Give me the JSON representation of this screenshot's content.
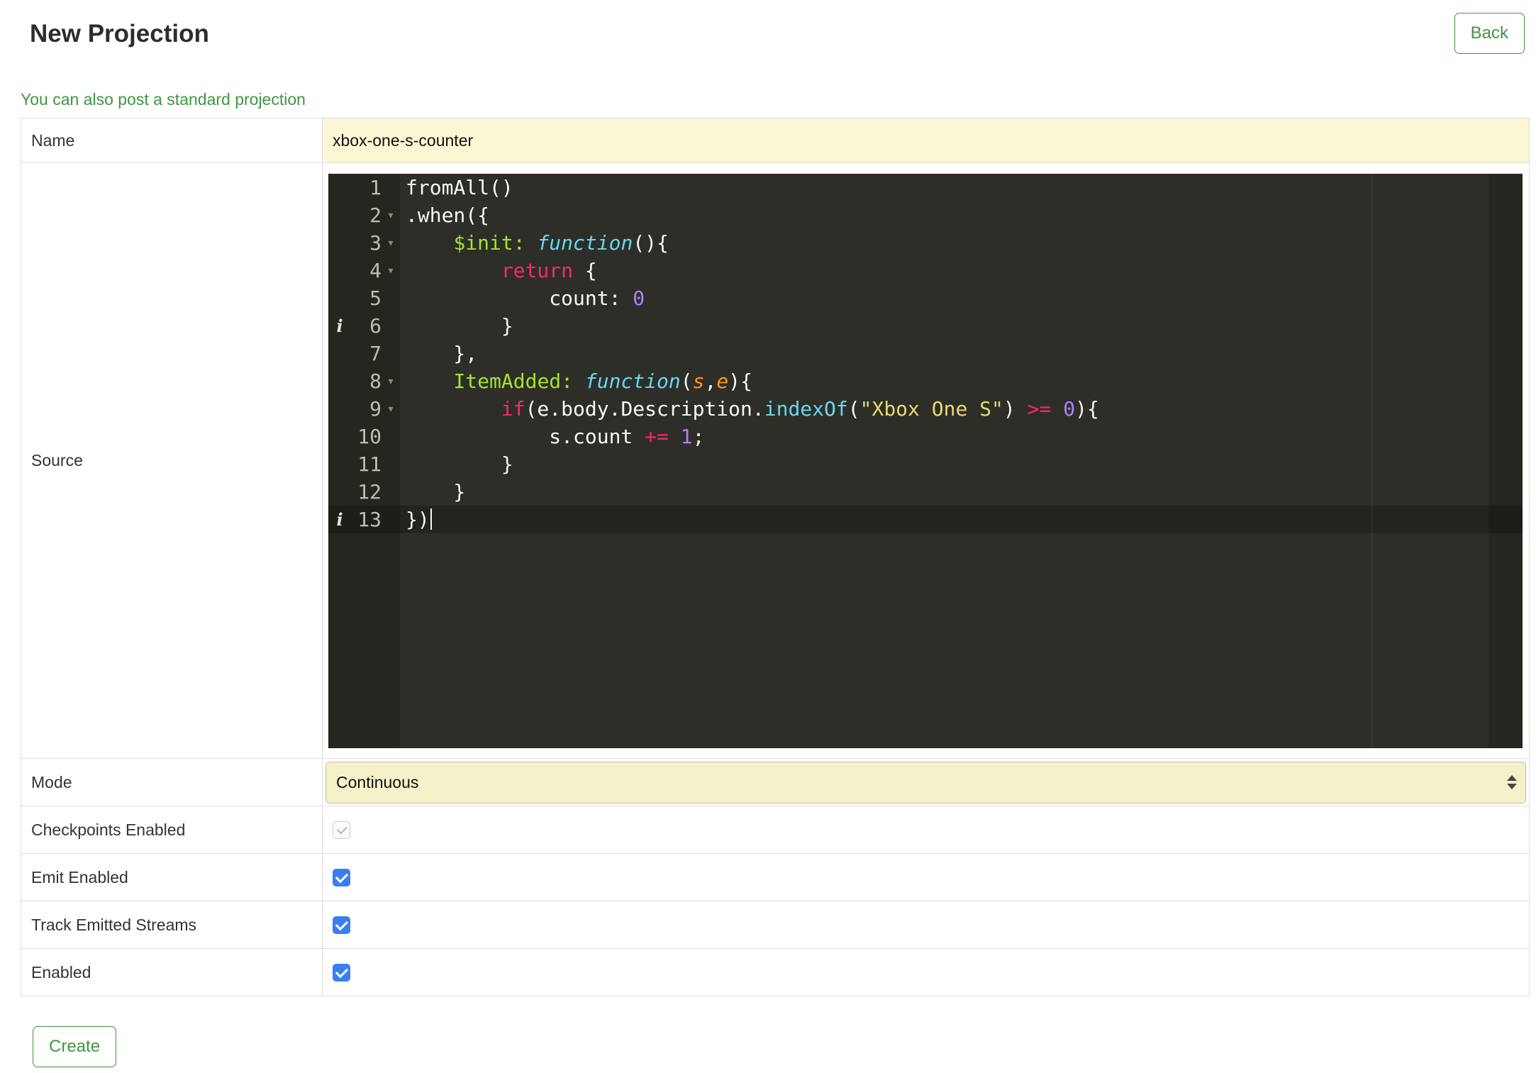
{
  "page": {
    "title": "New Projection",
    "back_label": "Back",
    "standard_link": "You can also post a standard projection",
    "create_label": "Create"
  },
  "form": {
    "name": {
      "label": "Name",
      "value": "xbox-one-s-counter"
    },
    "source": {
      "label": "Source"
    },
    "mode": {
      "label": "Mode",
      "value": "Continuous"
    },
    "checkpoints": {
      "label": "Checkpoints Enabled",
      "checked": true,
      "disabled": true
    },
    "emit": {
      "label": "Emit Enabled",
      "checked": true,
      "disabled": false
    },
    "track": {
      "label": "Track Emitted Streams",
      "checked": true,
      "disabled": false
    },
    "enabled": {
      "label": "Enabled",
      "checked": true,
      "disabled": false
    }
  },
  "editor": {
    "line_count": 13,
    "active_line": 13,
    "cursor_line": 13,
    "fold_lines": [
      2,
      3,
      4,
      8,
      9
    ],
    "info_lines": [
      6,
      13
    ],
    "icons": {
      "fold_open": "▾",
      "info": "i"
    },
    "lines": [
      [
        [
          "fromAll()",
          "t"
        ]
      ],
      [
        [
          ".when({",
          "t"
        ]
      ],
      [
        [
          "    ",
          "t"
        ],
        [
          "$init:",
          "p"
        ],
        [
          " ",
          "t"
        ],
        [
          "function",
          "f"
        ],
        [
          "(){",
          "t"
        ]
      ],
      [
        [
          "        ",
          "t"
        ],
        [
          "return",
          "k"
        ],
        [
          " {",
          "t"
        ]
      ],
      [
        [
          "            count: ",
          "t"
        ],
        [
          "0",
          "n"
        ]
      ],
      [
        [
          "        }",
          "t"
        ]
      ],
      [
        [
          "    },",
          "t"
        ]
      ],
      [
        [
          "    ",
          "t"
        ],
        [
          "ItemAdded:",
          "p"
        ],
        [
          " ",
          "t"
        ],
        [
          "function",
          "f"
        ],
        [
          "(",
          "t"
        ],
        [
          "s",
          "a"
        ],
        [
          ",",
          "t"
        ],
        [
          "e",
          "a"
        ],
        [
          "){",
          "t"
        ]
      ],
      [
        [
          "        ",
          "t"
        ],
        [
          "if",
          "k"
        ],
        [
          "(e.body.Description.",
          "t"
        ],
        [
          "indexOf",
          "b"
        ],
        [
          "(",
          "t"
        ],
        [
          "\"Xbox One S\"",
          "s"
        ],
        [
          ") ",
          "t"
        ],
        [
          ">=",
          "k"
        ],
        [
          " ",
          "t"
        ],
        [
          "0",
          "n"
        ],
        [
          "){",
          "t"
        ]
      ],
      [
        [
          "            s.count ",
          "t"
        ],
        [
          "+=",
          "k"
        ],
        [
          " ",
          "t"
        ],
        [
          "1",
          "n"
        ],
        [
          ";",
          "t"
        ]
      ],
      [
        [
          "        }",
          "t"
        ]
      ],
      [
        [
          "    }",
          "t"
        ]
      ],
      [
        [
          "})",
          "t"
        ]
      ]
    ]
  },
  "colors": {
    "accent_green": "#3f9640",
    "checkbox_blue": "#3a7ff2",
    "field_yellow": "#fbf7d5",
    "select_yellow": "#f5f1c8",
    "editor_bg": "#262620",
    "editor_text_bg": "#2e2e28",
    "code_plain": "#f8f8f2",
    "code_property": "#a6e22e",
    "code_keyword": "#f92672",
    "code_function": "#66d9ef",
    "code_number": "#ae81ff",
    "code_string": "#e6db74",
    "code_argument": "#fd971f",
    "table_border": "#dddddd"
  }
}
